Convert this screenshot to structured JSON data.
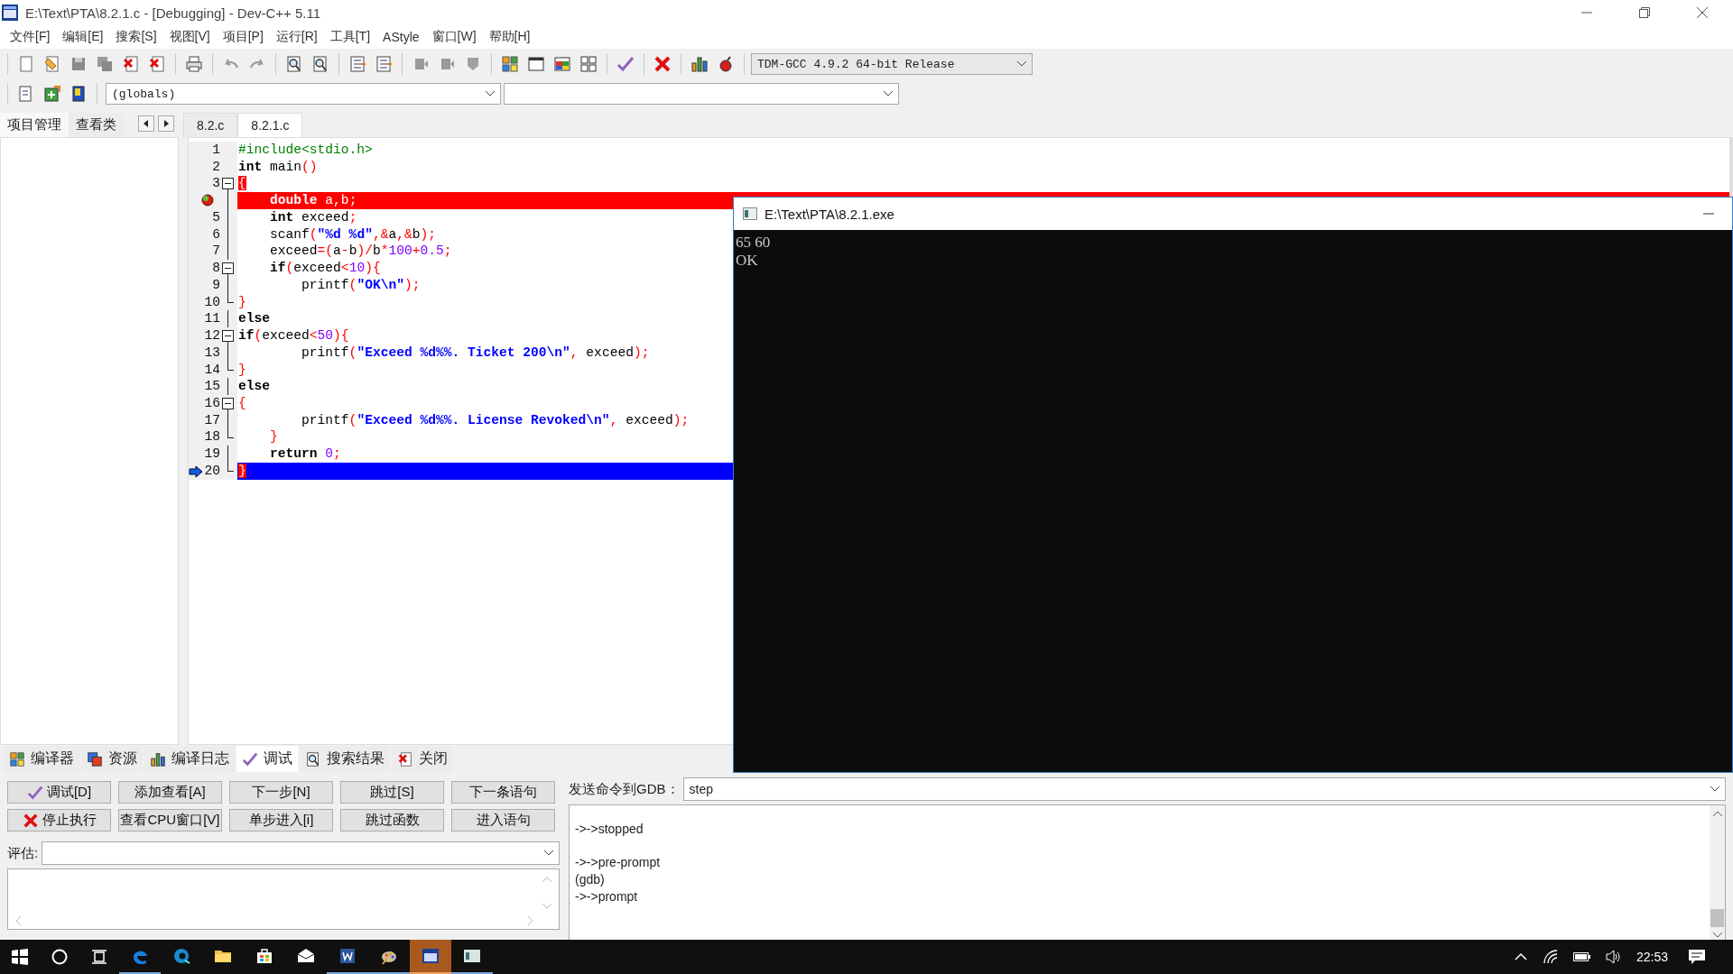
{
  "window": {
    "title": "E:\\Text\\PTA\\8.2.1.c - [Debugging] - Dev-C++ 5.11"
  },
  "menu": [
    "文件[F]",
    "编辑[E]",
    "搜索[S]",
    "视图[V]",
    "项目[P]",
    "运行[R]",
    "工具[T]",
    "AStyle",
    "窗口[W]",
    "帮助[H]"
  ],
  "toolbar": {
    "compiler": "TDM-GCC 4.9.2 64-bit Release",
    "scope": "(globals)"
  },
  "panel_tabs": [
    {
      "label": "项目管理",
      "selected": true
    },
    {
      "label": "查看类",
      "selected": false
    }
  ],
  "file_tabs": [
    {
      "label": "8.2.c",
      "selected": false
    },
    {
      "label": "8.2.1.c",
      "selected": true
    }
  ],
  "editor": {
    "lines": [
      {
        "number": "1",
        "breakpoint": false,
        "execution": false,
        "kind": "plain",
        "tokens": [
          {
            "kind": "pp",
            "text": "#include<stdio.h>"
          }
        ]
      },
      {
        "number": "2",
        "breakpoint": false,
        "execution": false,
        "kind": "plain",
        "tokens": [
          {
            "kind": "kw",
            "text": "int"
          },
          {
            "kind": "id",
            "text": " main"
          },
          {
            "kind": "sym",
            "text": "()"
          }
        ]
      },
      {
        "number": "3",
        "breakpoint": false,
        "execution": false,
        "kind": "fold-start",
        "tokens": [
          {
            "kind": "brace",
            "text": "{"
          }
        ]
      },
      {
        "breakpoint": true,
        "execution": false,
        "kind": "fold-body",
        "tokens": [
          {
            "kind": "kw",
            "text": "    double"
          },
          {
            "kind": "id",
            "text": " a"
          },
          {
            "kind": "sym",
            "text": ","
          },
          {
            "kind": "id",
            "text": "b"
          },
          {
            "kind": "sym",
            "text": ";"
          }
        ]
      },
      {
        "number": "5",
        "breakpoint": false,
        "execution": false,
        "kind": "fold-body",
        "tokens": [
          {
            "kind": "kw",
            "text": "    int"
          },
          {
            "kind": "id",
            "text": " exceed"
          },
          {
            "kind": "sym",
            "text": ";"
          }
        ]
      },
      {
        "number": "6",
        "breakpoint": false,
        "execution": false,
        "kind": "fold-body",
        "tokens": [
          {
            "kind": "id",
            "text": "    scanf"
          },
          {
            "kind": "sym",
            "text": "("
          },
          {
            "kind": "str",
            "text": "\"%d %d\""
          },
          {
            "kind": "sym",
            "text": ",&"
          },
          {
            "kind": "id",
            "text": "a"
          },
          {
            "kind": "sym",
            "text": ",&"
          },
          {
            "kind": "id",
            "text": "b"
          },
          {
            "kind": "sym",
            "text": ");"
          }
        ]
      },
      {
        "number": "7",
        "breakpoint": false,
        "execution": false,
        "kind": "fold-body",
        "tokens": [
          {
            "kind": "id",
            "text": "    exceed"
          },
          {
            "kind": "sym",
            "text": "=("
          },
          {
            "kind": "id",
            "text": "a"
          },
          {
            "kind": "sym",
            "text": "-"
          },
          {
            "kind": "id",
            "text": "b"
          },
          {
            "kind": "sym",
            "text": ")/"
          },
          {
            "kind": "id",
            "text": "b"
          },
          {
            "kind": "sym",
            "text": "*"
          },
          {
            "kind": "num",
            "text": "100"
          },
          {
            "kind": "sym",
            "text": "+"
          },
          {
            "kind": "num",
            "text": "0.5"
          },
          {
            "kind": "sym",
            "text": ";"
          }
        ]
      },
      {
        "number": "8",
        "breakpoint": false,
        "execution": false,
        "kind": "fold-start",
        "tokens": [
          {
            "kind": "kw",
            "text": "    if"
          },
          {
            "kind": "sym",
            "text": "("
          },
          {
            "kind": "id",
            "text": "exceed"
          },
          {
            "kind": "sym",
            "text": "<"
          },
          {
            "kind": "num",
            "text": "10"
          },
          {
            "kind": "sym",
            "text": "){"
          }
        ]
      },
      {
        "number": "9",
        "breakpoint": false,
        "execution": false,
        "kind": "fold-body",
        "tokens": [
          {
            "kind": "id",
            "text": "        printf"
          },
          {
            "kind": "sym",
            "text": "("
          },
          {
            "kind": "str",
            "text": "\"OK\\n\""
          },
          {
            "kind": "sym",
            "text": ");"
          }
        ]
      },
      {
        "number": "10",
        "breakpoint": false,
        "execution": false,
        "kind": "fold-end",
        "tokens": [
          {
            "kind": "sym",
            "text": "}"
          }
        ]
      },
      {
        "number": "11",
        "breakpoint": false,
        "execution": false,
        "kind": "fold-body",
        "tokens": [
          {
            "kind": "kw",
            "text": "else"
          }
        ]
      },
      {
        "number": "12",
        "breakpoint": false,
        "execution": false,
        "kind": "fold-start",
        "tokens": [
          {
            "kind": "kw",
            "text": "if"
          },
          {
            "kind": "sym",
            "text": "("
          },
          {
            "kind": "id",
            "text": "exceed"
          },
          {
            "kind": "sym",
            "text": "<"
          },
          {
            "kind": "num",
            "text": "50"
          },
          {
            "kind": "sym",
            "text": "){"
          }
        ]
      },
      {
        "number": "13",
        "breakpoint": false,
        "execution": false,
        "kind": "fold-body",
        "tokens": [
          {
            "kind": "id",
            "text": "        printf"
          },
          {
            "kind": "sym",
            "text": "("
          },
          {
            "kind": "str",
            "text": "\"Exceed %d%%. Ticket 200\\n\""
          },
          {
            "kind": "sym",
            "text": ","
          },
          {
            "kind": "id",
            "text": " exceed"
          },
          {
            "kind": "sym",
            "text": ");"
          }
        ]
      },
      {
        "number": "14",
        "breakpoint": false,
        "execution": false,
        "kind": "fold-end",
        "tokens": [
          {
            "kind": "sym",
            "text": "}"
          }
        ]
      },
      {
        "number": "15",
        "breakpoint": false,
        "execution": false,
        "kind": "fold-body",
        "tokens": [
          {
            "kind": "kw",
            "text": "else"
          }
        ]
      },
      {
        "number": "16",
        "breakpoint": false,
        "execution": false,
        "kind": "fold-start",
        "tokens": [
          {
            "kind": "sym",
            "text": "{"
          }
        ]
      },
      {
        "number": "17",
        "breakpoint": false,
        "execution": false,
        "kind": "fold-body",
        "tokens": [
          {
            "kind": "id",
            "text": "        printf"
          },
          {
            "kind": "sym",
            "text": "("
          },
          {
            "kind": "str",
            "text": "\"Exceed %d%%. License Revoked\\n\""
          },
          {
            "kind": "sym",
            "text": ","
          },
          {
            "kind": "id",
            "text": " exceed"
          },
          {
            "kind": "sym",
            "text": ");"
          }
        ]
      },
      {
        "number": "18",
        "breakpoint": false,
        "execution": false,
        "kind": "fold-end",
        "tokens": [
          {
            "kind": "sym",
            "text": "    }"
          }
        ]
      },
      {
        "number": "19",
        "breakpoint": false,
        "execution": false,
        "kind": "fold-body",
        "tokens": [
          {
            "kind": "kw",
            "text": "    return"
          },
          {
            "kind": "num",
            "text": " 0"
          },
          {
            "kind": "sym",
            "text": ";"
          }
        ]
      },
      {
        "number": "20",
        "breakpoint": false,
        "execution": true,
        "kind": "fold-end",
        "tokens": [
          {
            "kind": "brace",
            "text": "}"
          }
        ]
      }
    ]
  },
  "console": {
    "title": "E:\\Text\\PTA\\8.2.1.exe",
    "output": [
      "65 60",
      "OK"
    ]
  },
  "bottom_tabs": [
    {
      "label": "编译器",
      "kind": "compiler",
      "selected": false
    },
    {
      "label": "资源",
      "kind": "resources",
      "selected": false
    },
    {
      "label": "编译日志",
      "kind": "log",
      "selected": false
    },
    {
      "label": "调试",
      "kind": "debug",
      "selected": true
    },
    {
      "label": "搜索结果",
      "kind": "search",
      "selected": false
    },
    {
      "label": "关闭",
      "kind": "close",
      "selected": false
    }
  ],
  "debug": {
    "buttons": [
      {
        "label": "调试[D]",
        "kind": "check"
      },
      {
        "label": "添加查看[A]",
        "kind": "plain"
      },
      {
        "label": "下一步[N]",
        "kind": "plain"
      },
      {
        "label": "跳过[S]",
        "kind": "plain"
      },
      {
        "label": "下一条语句",
        "kind": "plain"
      },
      {
        "label": "停止执行",
        "kind": "cross"
      },
      {
        "label": "查看CPU窗口[V]",
        "kind": "plain"
      },
      {
        "label": "单步进入[i]",
        "kind": "plain"
      },
      {
        "label": "跳过函数",
        "kind": "plain"
      },
      {
        "label": "进入语句",
        "kind": "plain"
      }
    ],
    "evaluate_label": "评估:"
  },
  "gdb": {
    "label": "发送命令到GDB：",
    "value": "step",
    "output": [
      [
        "->->stopped"
      ],
      [
        "->->pre-prompt",
        "(gdb)",
        "->->prompt"
      ]
    ]
  },
  "taskbar": {
    "apps": [
      {
        "kind": "edge",
        "running": true,
        "selected": false
      },
      {
        "kind": "browser",
        "running": false,
        "selected": false
      },
      {
        "kind": "folder",
        "running": false,
        "selected": false
      },
      {
        "kind": "store",
        "running": false,
        "selected": false
      },
      {
        "kind": "mail",
        "running": false,
        "selected": false
      },
      {
        "kind": "word",
        "running": true,
        "selected": false
      },
      {
        "kind": "paint",
        "running": true,
        "selected": false
      },
      {
        "kind": "devcpp",
        "running": true,
        "selected": true
      },
      {
        "kind": "console",
        "running": true,
        "selected": false
      }
    ],
    "time": "22:53"
  }
}
